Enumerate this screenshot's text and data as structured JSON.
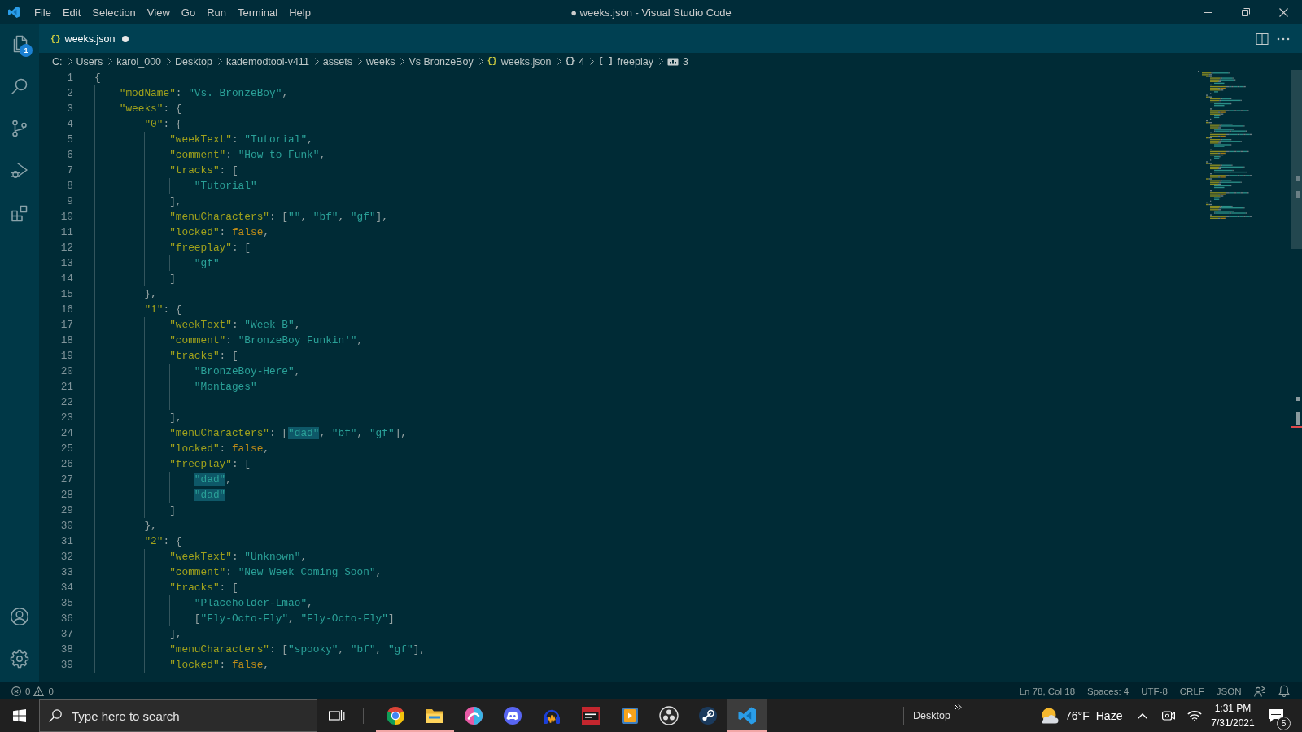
{
  "window": {
    "title": "● weeks.json - Visual Studio Code"
  },
  "menu": [
    "File",
    "Edit",
    "Selection",
    "View",
    "Go",
    "Run",
    "Terminal",
    "Help"
  ],
  "activity_bar": {
    "top": [
      {
        "kind": "explorer",
        "badge": "1"
      },
      {
        "kind": "search"
      },
      {
        "kind": "source-control"
      },
      {
        "kind": "run-debug"
      },
      {
        "kind": "extensions"
      }
    ],
    "bottom": [
      {
        "kind": "account"
      },
      {
        "kind": "settings"
      }
    ]
  },
  "tabs": [
    {
      "label": "weeks.json",
      "icon": "{}",
      "selected": true,
      "modified": true
    }
  ],
  "breadcrumbs": [
    {
      "kind": "folder",
      "label": "C:"
    },
    {
      "kind": "folder",
      "label": "Users"
    },
    {
      "kind": "folder",
      "label": "karol_000"
    },
    {
      "kind": "folder",
      "label": "Desktop"
    },
    {
      "kind": "folder",
      "label": "kademodtool-v411"
    },
    {
      "kind": "folder",
      "label": "assets"
    },
    {
      "kind": "folder",
      "label": "weeks"
    },
    {
      "kind": "folder",
      "label": "Vs BronzeBoy"
    },
    {
      "kind": "file",
      "icon": "{}",
      "label": "weeks.json"
    },
    {
      "kind": "object",
      "icon": "{}",
      "label": "4"
    },
    {
      "kind": "array",
      "icon": "[ ]",
      "label": "freeplay"
    },
    {
      "kind": "string",
      "label": "3"
    }
  ],
  "editor": {
    "lines": [
      {
        "number": "1",
        "tokens": [
          {
            "kind": "punct",
            "text": "{"
          }
        ],
        "children": [
          {
            "number": "2",
            "tokens": [
              {
                "kind": "key",
                "text": "\"modName\""
              },
              {
                "kind": "punct",
                "text": ": "
              },
              {
                "kind": "string",
                "text": "\"Vs. BronzeBoy\""
              },
              {
                "kind": "punct",
                "text": ","
              }
            ]
          },
          {
            "number": "3",
            "tokens": [
              {
                "kind": "key",
                "text": "\"weeks\""
              },
              {
                "kind": "punct",
                "text": ": {"
              }
            ],
            "children": [
              {
                "number": "4",
                "tokens": [
                  {
                    "kind": "key",
                    "text": "\"0\""
                  },
                  {
                    "kind": "punct",
                    "text": ": {"
                  }
                ],
                "children": [
                  {
                    "number": "5",
                    "tokens": [
                      {
                        "kind": "key",
                        "text": "\"weekText\""
                      },
                      {
                        "kind": "punct",
                        "text": ": "
                      },
                      {
                        "kind": "string",
                        "text": "\"Tutorial\""
                      },
                      {
                        "kind": "punct",
                        "text": ","
                      }
                    ]
                  },
                  {
                    "number": "6",
                    "tokens": [
                      {
                        "kind": "key",
                        "text": "\"comment\""
                      },
                      {
                        "kind": "punct",
                        "text": ": "
                      },
                      {
                        "kind": "string",
                        "text": "\"How to Funk\""
                      },
                      {
                        "kind": "punct",
                        "text": ","
                      }
                    ]
                  },
                  {
                    "number": "7",
                    "tokens": [
                      {
                        "kind": "key",
                        "text": "\"tracks\""
                      },
                      {
                        "kind": "punct",
                        "text": ": ["
                      }
                    ],
                    "children": [
                      {
                        "number": "8",
                        "tokens": [
                          {
                            "kind": "string",
                            "text": "\"Tutorial\""
                          }
                        ]
                      }
                    ]
                  },
                  {
                    "number": "9",
                    "tokens": [
                      {
                        "kind": "punct",
                        "text": "],"
                      }
                    ]
                  },
                  {
                    "number": "10",
                    "tokens": [
                      {
                        "kind": "key",
                        "text": "\"menuCharacters\""
                      },
                      {
                        "kind": "punct",
                        "text": ": ["
                      },
                      {
                        "kind": "string",
                        "text": "\"\""
                      },
                      {
                        "kind": "punct",
                        "text": ", "
                      },
                      {
                        "kind": "string",
                        "text": "\"bf\""
                      },
                      {
                        "kind": "punct",
                        "text": ", "
                      },
                      {
                        "kind": "string",
                        "text": "\"gf\""
                      },
                      {
                        "kind": "punct",
                        "text": "],"
                      }
                    ]
                  },
                  {
                    "number": "11",
                    "tokens": [
                      {
                        "kind": "key",
                        "text": "\"locked\""
                      },
                      {
                        "kind": "punct",
                        "text": ": "
                      },
                      {
                        "kind": "keyword",
                        "text": "false"
                      },
                      {
                        "kind": "punct",
                        "text": ","
                      }
                    ]
                  },
                  {
                    "number": "12",
                    "tokens": [
                      {
                        "kind": "key",
                        "text": "\"freeplay\""
                      },
                      {
                        "kind": "punct",
                        "text": ": ["
                      }
                    ],
                    "children": [
                      {
                        "number": "13",
                        "tokens": [
                          {
                            "kind": "string",
                            "text": "\"gf\""
                          }
                        ]
                      }
                    ]
                  },
                  {
                    "number": "14",
                    "tokens": [
                      {
                        "kind": "punct",
                        "text": "]"
                      }
                    ]
                  }
                ]
              },
              {
                "number": "15",
                "tokens": [
                  {
                    "kind": "punct",
                    "text": "},"
                  }
                ]
              },
              {
                "number": "16",
                "tokens": [
                  {
                    "kind": "key",
                    "text": "\"1\""
                  },
                  {
                    "kind": "punct",
                    "text": ": {"
                  }
                ],
                "children": [
                  {
                    "number": "17",
                    "tokens": [
                      {
                        "kind": "key",
                        "text": "\"weekText\""
                      },
                      {
                        "kind": "punct",
                        "text": ": "
                      },
                      {
                        "kind": "string",
                        "text": "\"Week B\""
                      },
                      {
                        "kind": "punct",
                        "text": ","
                      }
                    ]
                  },
                  {
                    "number": "18",
                    "tokens": [
                      {
                        "kind": "key",
                        "text": "\"comment\""
                      },
                      {
                        "kind": "punct",
                        "text": ": "
                      },
                      {
                        "kind": "string",
                        "text": "\"BronzeBoy Funkin'\""
                      },
                      {
                        "kind": "punct",
                        "text": ","
                      }
                    ]
                  },
                  {
                    "number": "19",
                    "tokens": [
                      {
                        "kind": "key",
                        "text": "\"tracks\""
                      },
                      {
                        "kind": "punct",
                        "text": ": ["
                      }
                    ],
                    "children": [
                      {
                        "number": "20",
                        "tokens": [
                          {
                            "kind": "string",
                            "text": "\"BronzeBoy-Here\""
                          },
                          {
                            "kind": "punct",
                            "text": ","
                          }
                        ]
                      },
                      {
                        "number": "21",
                        "tokens": [
                          {
                            "kind": "string",
                            "text": "\"Montages\""
                          }
                        ]
                      },
                      {
                        "number": "22"
                      }
                    ]
                  },
                  {
                    "number": "23",
                    "tokens": [
                      {
                        "kind": "punct",
                        "text": "],"
                      }
                    ]
                  },
                  {
                    "number": "24",
                    "tokens": [
                      {
                        "kind": "key",
                        "text": "\"menuCharacters\""
                      },
                      {
                        "kind": "punct",
                        "text": ": ["
                      },
                      {
                        "kind": "match",
                        "text": "\"dad\""
                      },
                      {
                        "kind": "punct",
                        "text": ", "
                      },
                      {
                        "kind": "string",
                        "text": "\"bf\""
                      },
                      {
                        "kind": "punct",
                        "text": ", "
                      },
                      {
                        "kind": "string",
                        "text": "\"gf\""
                      },
                      {
                        "kind": "punct",
                        "text": "],"
                      }
                    ]
                  },
                  {
                    "number": "25",
                    "tokens": [
                      {
                        "kind": "key",
                        "text": "\"locked\""
                      },
                      {
                        "kind": "punct",
                        "text": ": "
                      },
                      {
                        "kind": "keyword",
                        "text": "false"
                      },
                      {
                        "kind": "punct",
                        "text": ","
                      }
                    ]
                  },
                  {
                    "number": "26",
                    "tokens": [
                      {
                        "kind": "key",
                        "text": "\"freeplay\""
                      },
                      {
                        "kind": "punct",
                        "text": ": ["
                      }
                    ],
                    "children": [
                      {
                        "number": "27",
                        "tokens": [
                          {
                            "kind": "match",
                            "text": "\"dad\""
                          },
                          {
                            "kind": "punct",
                            "text": ","
                          }
                        ]
                      },
                      {
                        "number": "28",
                        "tokens": [
                          {
                            "kind": "match",
                            "text": "\"dad\""
                          }
                        ]
                      }
                    ]
                  },
                  {
                    "number": "29",
                    "tokens": [
                      {
                        "kind": "punct",
                        "text": "]"
                      }
                    ]
                  }
                ]
              },
              {
                "number": "30",
                "tokens": [
                  {
                    "kind": "punct",
                    "text": "},"
                  }
                ]
              },
              {
                "number": "31",
                "tokens": [
                  {
                    "kind": "key",
                    "text": "\"2\""
                  },
                  {
                    "kind": "punct",
                    "text": ": {"
                  }
                ],
                "children": [
                  {
                    "number": "32",
                    "tokens": [
                      {
                        "kind": "key",
                        "text": "\"weekText\""
                      },
                      {
                        "kind": "punct",
                        "text": ": "
                      },
                      {
                        "kind": "string",
                        "text": "\"Unknown\""
                      },
                      {
                        "kind": "punct",
                        "text": ","
                      }
                    ]
                  },
                  {
                    "number": "33",
                    "tokens": [
                      {
                        "kind": "key",
                        "text": "\"comment\""
                      },
                      {
                        "kind": "punct",
                        "text": ": "
                      },
                      {
                        "kind": "string",
                        "text": "\"New Week Coming Soon\""
                      },
                      {
                        "kind": "punct",
                        "text": ","
                      }
                    ]
                  },
                  {
                    "number": "34",
                    "tokens": [
                      {
                        "kind": "key",
                        "text": "\"tracks\""
                      },
                      {
                        "kind": "punct",
                        "text": ": ["
                      }
                    ],
                    "children": [
                      {
                        "number": "35",
                        "tokens": [
                          {
                            "kind": "string",
                            "text": "\"Placeholder-Lmao\""
                          },
                          {
                            "kind": "punct",
                            "text": ","
                          }
                        ]
                      },
                      {
                        "number": "36",
                        "tokens": [
                          {
                            "kind": "punct",
                            "text": "["
                          },
                          {
                            "kind": "string",
                            "text": "\"Fly-Octo-Fly\""
                          },
                          {
                            "kind": "punct",
                            "text": ", "
                          },
                          {
                            "kind": "string",
                            "text": "\"Fly-Octo-Fly\""
                          },
                          {
                            "kind": "punct",
                            "text": "]"
                          }
                        ]
                      }
                    ]
                  },
                  {
                    "number": "37",
                    "tokens": [
                      {
                        "kind": "punct",
                        "text": "],"
                      }
                    ]
                  },
                  {
                    "number": "38",
                    "tokens": [
                      {
                        "kind": "key",
                        "text": "\"menuCharacters\""
                      },
                      {
                        "kind": "punct",
                        "text": ": ["
                      },
                      {
                        "kind": "string",
                        "text": "\"spooky\""
                      },
                      {
                        "kind": "punct",
                        "text": ", "
                      },
                      {
                        "kind": "string",
                        "text": "\"bf\""
                      },
                      {
                        "kind": "punct",
                        "text": ", "
                      },
                      {
                        "kind": "string",
                        "text": "\"gf\""
                      },
                      {
                        "kind": "punct",
                        "text": "],"
                      }
                    ]
                  },
                  {
                    "number": "39",
                    "tokens": [
                      {
                        "kind": "key",
                        "text": "\"locked\""
                      },
                      {
                        "kind": "punct",
                        "text": ": "
                      },
                      {
                        "kind": "keyword",
                        "text": "false"
                      },
                      {
                        "kind": "punct",
                        "text": ","
                      }
                    ]
                  }
                ]
              }
            ]
          }
        ]
      }
    ]
  },
  "status_bar": {
    "errors": "0",
    "warnings": "0",
    "items": [
      "Ln 78, Col 18",
      "Spaces: 4",
      "UTF-8",
      "CRLF",
      "JSON"
    ]
  },
  "taskbar": {
    "search": {
      "placeholder": "Type here to search"
    },
    "apps": [
      {
        "kind": "browser",
        "running": true,
        "active": false
      },
      {
        "kind": "files",
        "running": true,
        "active": false
      },
      {
        "kind": "paint",
        "running": false,
        "active": false
      },
      {
        "kind": "chat",
        "running": false,
        "active": false
      },
      {
        "kind": "audio",
        "running": false,
        "active": false
      },
      {
        "kind": "archive",
        "running": false,
        "active": false
      },
      {
        "kind": "player",
        "running": false,
        "active": false
      },
      {
        "kind": "recorder",
        "running": false,
        "active": false
      },
      {
        "kind": "games",
        "running": false,
        "active": false
      },
      {
        "kind": "editor",
        "running": true,
        "active": true
      }
    ],
    "toolbar": {
      "label": "Desktop"
    },
    "weather": {
      "temperature": "76°F",
      "condition": "Haze"
    },
    "clock": {
      "time": "1:31 PM",
      "date": "7/31/2021"
    },
    "notifications": {
      "count": "5"
    }
  }
}
